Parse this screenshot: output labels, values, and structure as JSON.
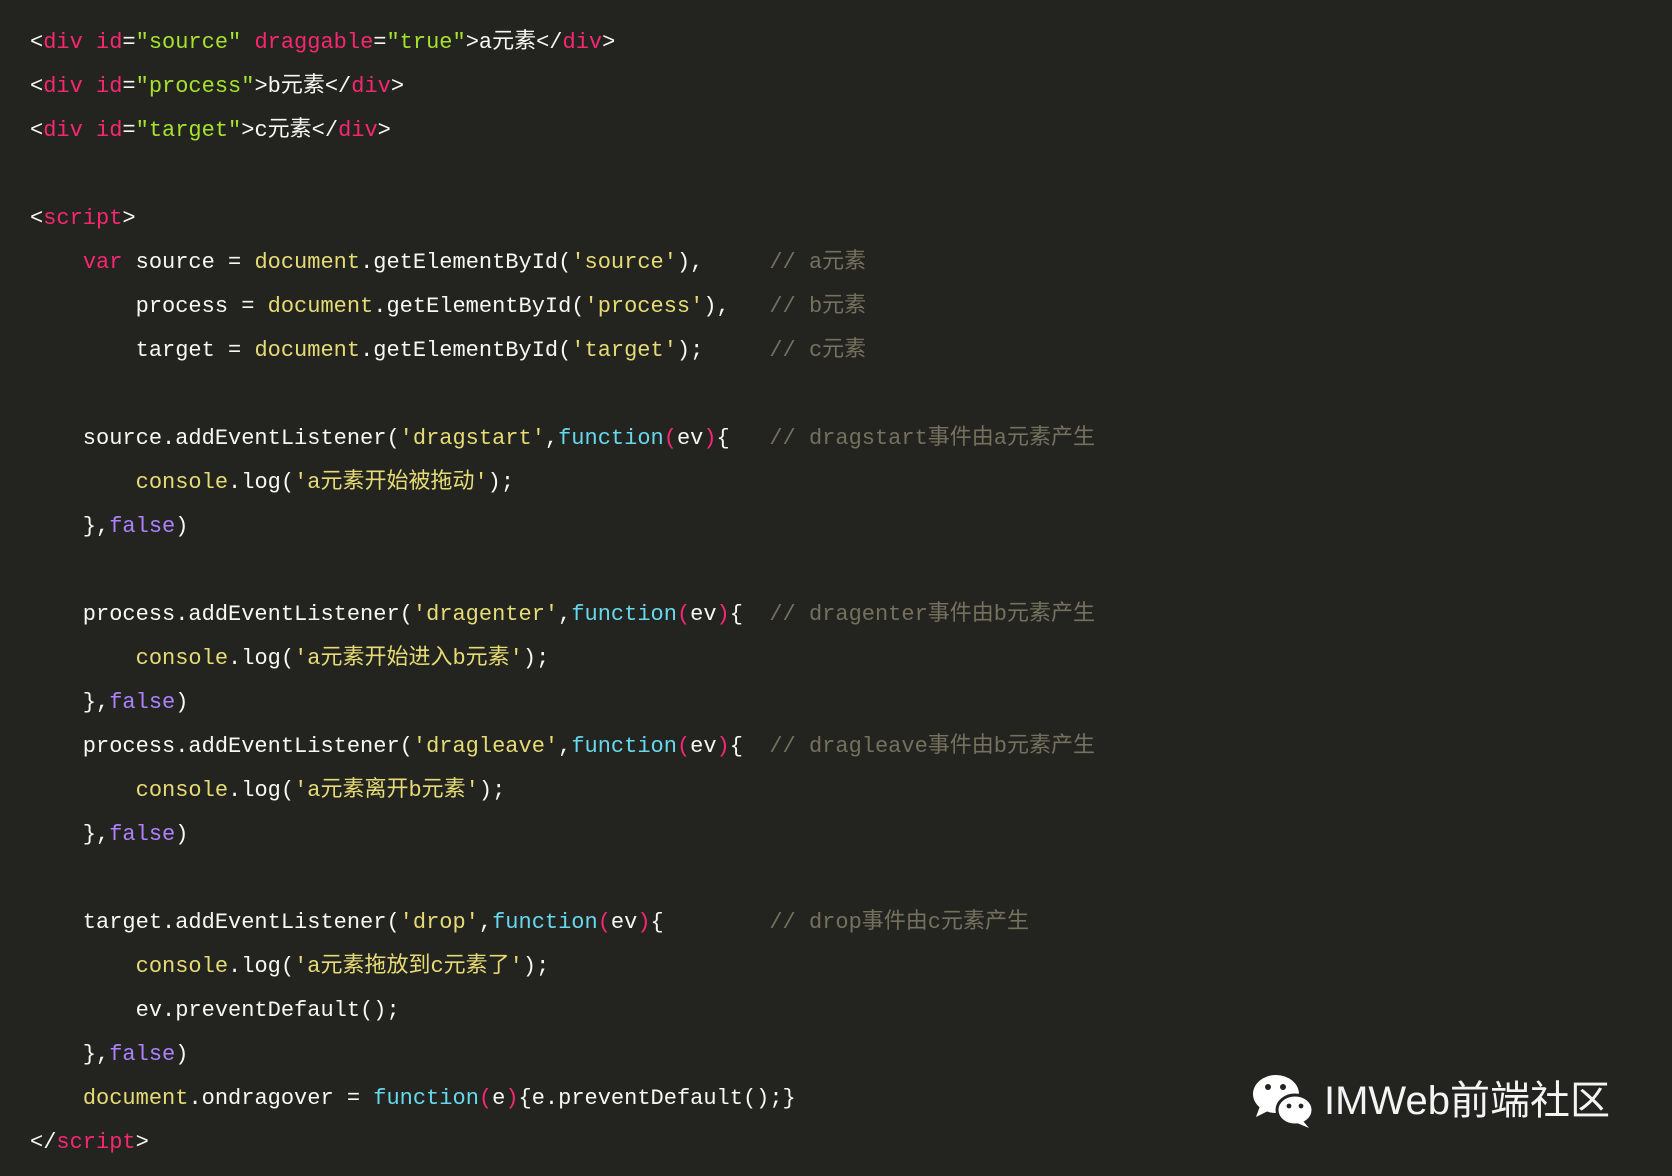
{
  "theme": {
    "background": "#23241f",
    "text": "#f8f8f2"
  },
  "code": {
    "lines": [
      [
        {
          "text": "<"
        },
        {
          "text": "div",
          "color": "#f92672"
        },
        {
          "text": " "
        },
        {
          "text": "id",
          "color": "#f92672"
        },
        {
          "text": "="
        },
        {
          "text": "\"source\"",
          "color": "#a6e22e"
        },
        {
          "text": " "
        },
        {
          "text": "draggable",
          "color": "#f92672"
        },
        {
          "text": "="
        },
        {
          "text": "\"true\"",
          "color": "#a6e22e"
        },
        {
          "text": ">a元素</"
        },
        {
          "text": "div",
          "color": "#f92672"
        },
        {
          "text": ">"
        }
      ],
      [
        {
          "text": "<"
        },
        {
          "text": "div",
          "color": "#f92672"
        },
        {
          "text": " "
        },
        {
          "text": "id",
          "color": "#f92672"
        },
        {
          "text": "="
        },
        {
          "text": "\"process\"",
          "color": "#a6e22e"
        },
        {
          "text": ">b元素</"
        },
        {
          "text": "div",
          "color": "#f92672"
        },
        {
          "text": ">"
        }
      ],
      [
        {
          "text": "<"
        },
        {
          "text": "div",
          "color": "#f92672"
        },
        {
          "text": " "
        },
        {
          "text": "id",
          "color": "#f92672"
        },
        {
          "text": "="
        },
        {
          "text": "\"target\"",
          "color": "#a6e22e"
        },
        {
          "text": ">c元素</"
        },
        {
          "text": "div",
          "color": "#f92672"
        },
        {
          "text": ">"
        }
      ],
      [],
      [
        {
          "text": "<"
        },
        {
          "text": "script",
          "color": "#f92672"
        },
        {
          "text": ">"
        }
      ],
      [
        {
          "text": "    "
        },
        {
          "text": "var",
          "color": "#f92672"
        },
        {
          "text": " source = "
        },
        {
          "text": "document",
          "color": "#e6db74"
        },
        {
          "text": ".getElementById("
        },
        {
          "text": "'source'",
          "color": "#e6db74"
        },
        {
          "text": "),     "
        },
        {
          "text": "// a元素",
          "color": "#75715e"
        }
      ],
      [
        {
          "text": "        process = "
        },
        {
          "text": "document",
          "color": "#e6db74"
        },
        {
          "text": ".getElementById("
        },
        {
          "text": "'process'",
          "color": "#e6db74"
        },
        {
          "text": "),   "
        },
        {
          "text": "// b元素",
          "color": "#75715e"
        }
      ],
      [
        {
          "text": "        target = "
        },
        {
          "text": "document",
          "color": "#e6db74"
        },
        {
          "text": ".getElementById("
        },
        {
          "text": "'target'",
          "color": "#e6db74"
        },
        {
          "text": ");     "
        },
        {
          "text": "// c元素",
          "color": "#75715e"
        }
      ],
      [],
      [
        {
          "text": "    source.addEventListener("
        },
        {
          "text": "'dragstart'",
          "color": "#e6db74"
        },
        {
          "text": ","
        },
        {
          "text": "function",
          "color": "#66d9ef"
        },
        {
          "text": "(",
          "color": "#f92672"
        },
        {
          "text": "ev"
        },
        {
          "text": ")",
          "color": "#f92672"
        },
        {
          "text": "{   "
        },
        {
          "text": "// dragstart事件由a元素产生",
          "color": "#75715e"
        }
      ],
      [
        {
          "text": "        "
        },
        {
          "text": "console",
          "color": "#e6db74"
        },
        {
          "text": ".log("
        },
        {
          "text": "'a元素开始被拖动'",
          "color": "#e6db74"
        },
        {
          "text": ");"
        }
      ],
      [
        {
          "text": "    },"
        },
        {
          "text": "false",
          "color": "#ae81ff"
        },
        {
          "text": ")"
        }
      ],
      [],
      [
        {
          "text": "    process.addEventListener("
        },
        {
          "text": "'dragenter'",
          "color": "#e6db74"
        },
        {
          "text": ","
        },
        {
          "text": "function",
          "color": "#66d9ef"
        },
        {
          "text": "(",
          "color": "#f92672"
        },
        {
          "text": "ev"
        },
        {
          "text": ")",
          "color": "#f92672"
        },
        {
          "text": "{  "
        },
        {
          "text": "// dragenter事件由b元素产生",
          "color": "#75715e"
        }
      ],
      [
        {
          "text": "        "
        },
        {
          "text": "console",
          "color": "#e6db74"
        },
        {
          "text": ".log("
        },
        {
          "text": "'a元素开始进入b元素'",
          "color": "#e6db74"
        },
        {
          "text": ");"
        }
      ],
      [
        {
          "text": "    },"
        },
        {
          "text": "false",
          "color": "#ae81ff"
        },
        {
          "text": ")"
        }
      ],
      [
        {
          "text": "    process.addEventListener("
        },
        {
          "text": "'dragleave'",
          "color": "#e6db74"
        },
        {
          "text": ","
        },
        {
          "text": "function",
          "color": "#66d9ef"
        },
        {
          "text": "(",
          "color": "#f92672"
        },
        {
          "text": "ev"
        },
        {
          "text": ")",
          "color": "#f92672"
        },
        {
          "text": "{  "
        },
        {
          "text": "// dragleave事件由b元素产生",
          "color": "#75715e"
        }
      ],
      [
        {
          "text": "        "
        },
        {
          "text": "console",
          "color": "#e6db74"
        },
        {
          "text": ".log("
        },
        {
          "text": "'a元素离开b元素'",
          "color": "#e6db74"
        },
        {
          "text": ");"
        }
      ],
      [
        {
          "text": "    },"
        },
        {
          "text": "false",
          "color": "#ae81ff"
        },
        {
          "text": ")"
        }
      ],
      [],
      [
        {
          "text": "    target.addEventListener("
        },
        {
          "text": "'drop'",
          "color": "#e6db74"
        },
        {
          "text": ","
        },
        {
          "text": "function",
          "color": "#66d9ef"
        },
        {
          "text": "(",
          "color": "#f92672"
        },
        {
          "text": "ev"
        },
        {
          "text": ")",
          "color": "#f92672"
        },
        {
          "text": "{        "
        },
        {
          "text": "// drop事件由c元素产生",
          "color": "#75715e"
        }
      ],
      [
        {
          "text": "        "
        },
        {
          "text": "console",
          "color": "#e6db74"
        },
        {
          "text": ".log("
        },
        {
          "text": "'a元素拖放到c元素了'",
          "color": "#e6db74"
        },
        {
          "text": ");"
        }
      ],
      [
        {
          "text": "        ev.preventDefault();"
        }
      ],
      [
        {
          "text": "    },"
        },
        {
          "text": "false",
          "color": "#ae81ff"
        },
        {
          "text": ")"
        }
      ],
      [
        {
          "text": "    "
        },
        {
          "text": "document",
          "color": "#e6db74"
        },
        {
          "text": ".ondragover = "
        },
        {
          "text": "function",
          "color": "#66d9ef"
        },
        {
          "text": "(",
          "color": "#f92672"
        },
        {
          "text": "e"
        },
        {
          "text": ")",
          "color": "#f92672"
        },
        {
          "text": "{e.preventDefault();}"
        }
      ],
      [
        {
          "text": "</"
        },
        {
          "text": "script",
          "color": "#f92672"
        },
        {
          "text": ">"
        }
      ]
    ]
  },
  "watermark": {
    "icon": "wechat-icon",
    "text": "IMWeb前端社区",
    "color": "#f4f4f4"
  }
}
